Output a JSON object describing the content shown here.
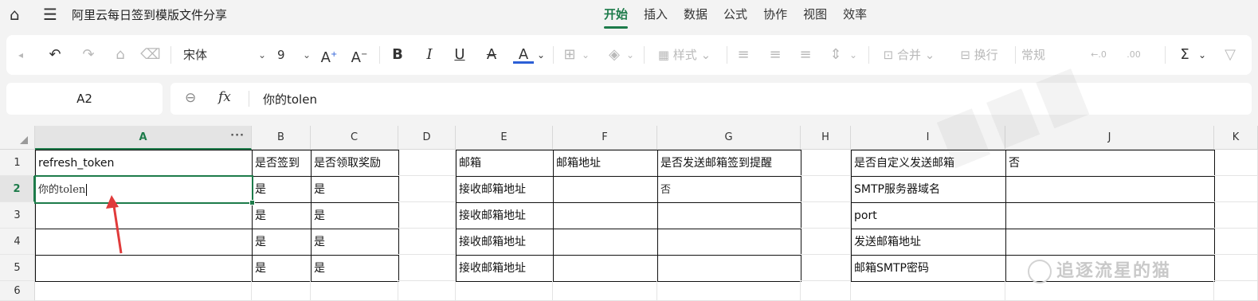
{
  "app": {
    "document_title": "阿里云每日签到模版文件分享",
    "menu": [
      {
        "label": "开始",
        "active": true
      },
      {
        "label": "插入",
        "active": false
      },
      {
        "label": "数据",
        "active": false
      },
      {
        "label": "公式",
        "active": false
      },
      {
        "label": "协作",
        "active": false
      },
      {
        "label": "视图",
        "active": false
      },
      {
        "label": "效率",
        "active": false
      }
    ]
  },
  "toolbar": {
    "font_name": "宋体",
    "font_size": "9",
    "style_label": "样式",
    "merge_label": "合并",
    "wrap_label": "换行",
    "number_format": "常规",
    "font_color": "#2c5fd6"
  },
  "formula_bar": {
    "cell_ref": "A2",
    "fx": "fx",
    "value": "你的tolen"
  },
  "sheet": {
    "columns": [
      "A",
      "B",
      "C",
      "D",
      "E",
      "F",
      "G",
      "H",
      "I",
      "J",
      "K"
    ],
    "rows": [
      "1",
      "2",
      "3",
      "4",
      "5",
      "6"
    ],
    "selected_column": "A",
    "selected_row": "2",
    "cells": {
      "A1": "refresh_token",
      "B1": "是否签到",
      "C1": "是否领取奖励",
      "E1": "邮箱",
      "F1": "邮箱地址",
      "G1": "是否发送邮箱签到提醒",
      "I1": "是否自定义发送邮箱",
      "J1": "否",
      "A2": "你的tolen",
      "B2": "是",
      "C2": "是",
      "E2": "接收邮箱地址",
      "G2": "否",
      "I2": "SMTP服务器域名",
      "B3": "是",
      "C3": "是",
      "E3": "接收邮箱地址",
      "I3": "port",
      "B4": "是",
      "C4": "是",
      "E4": "接收邮箱地址",
      "I4": "发送邮箱地址",
      "B5": "是",
      "C5": "是",
      "E5": "接收邮箱地址",
      "I5": "邮箱SMTP密码"
    }
  },
  "watermark": {
    "brand": "追逐流星的猫"
  },
  "colors": {
    "accent": "#1d7b4a",
    "annotation_arrow": "#e03b3b"
  }
}
